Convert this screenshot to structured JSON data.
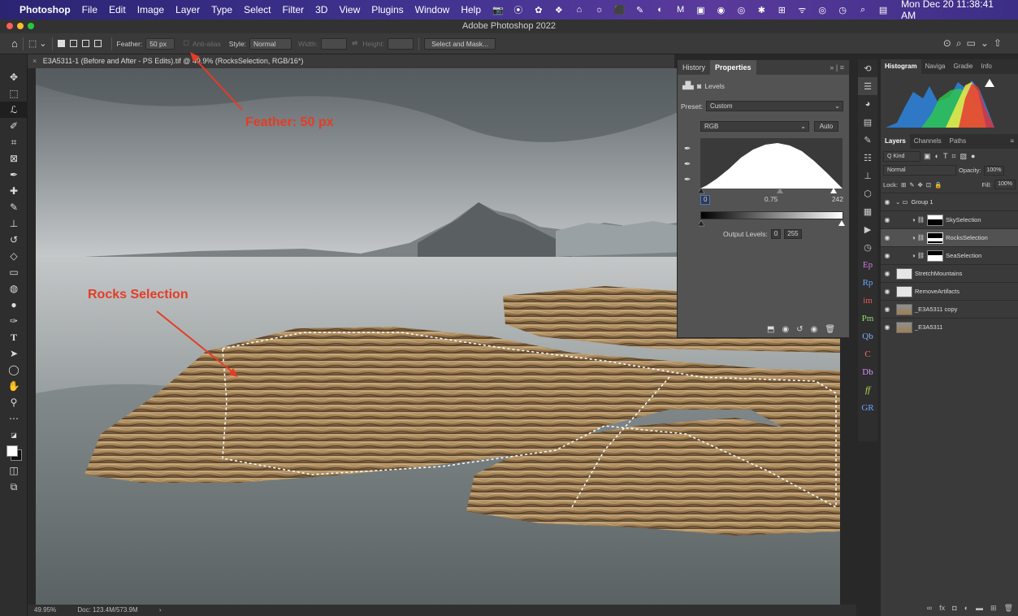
{
  "menubar": {
    "apple": "",
    "app": "Photoshop",
    "items": [
      "File",
      "Edit",
      "Image",
      "Layer",
      "Type",
      "Select",
      "Filter",
      "3D",
      "View",
      "Plugins",
      "Window",
      "Help"
    ],
    "status_icons": [
      "📷",
      "⦿",
      "✿",
      "❖",
      "⌂",
      "☼",
      "⬛",
      "✎",
      "◐",
      "M",
      "▣",
      "◉",
      "◎",
      "✱",
      "⊞",
      "ᯤ",
      "◎",
      "◷",
      "⌕",
      "▤"
    ],
    "datetime": "Mon Dec 20  11:38:41 AM"
  },
  "window": {
    "title": "Adobe Photoshop 2022"
  },
  "options": {
    "feather_label": "Feather:",
    "feather_value": "50 px",
    "antialias": "Anti-alias",
    "style_label": "Style:",
    "style_value": "Normal",
    "width_label": "Width:",
    "height_label": "Height:",
    "select_mask": "Select and Mask..."
  },
  "document": {
    "tab": "E3A5311-1 (Before and After - PS Edits).tif @ 49.9% (RocksSelection, RGB/16*)",
    "zoom": "49.95%",
    "doc_size": "Doc: 123.4M/573.9M"
  },
  "annotations": {
    "feather": "Feather: 50 px",
    "rocks": "Rocks Selection"
  },
  "properties": {
    "tabs": [
      "History",
      "Properties"
    ],
    "adjustment": "Levels",
    "preset_label": "Preset:",
    "preset_value": "Custom",
    "channel": "RGB",
    "auto": "Auto",
    "input_black": "0",
    "input_mid": "0.75",
    "input_white": "242",
    "output_label": "Output Levels:",
    "output_black": "0",
    "output_white": "255"
  },
  "right_panel": {
    "top_tabs": [
      "Histogram",
      "Naviga",
      "Gradie",
      "Info"
    ],
    "layer_tabs": [
      "Layers",
      "Channels",
      "Paths"
    ],
    "kind": "Q Kind",
    "blend": "Normal",
    "opacity_label": "Opacity:",
    "opacity_value": "100%",
    "lock_label": "Lock:",
    "fill_label": "Fill:",
    "fill_value": "100%",
    "layers": [
      {
        "name": "Group 1",
        "type": "group"
      },
      {
        "name": "SkySelection",
        "type": "adj"
      },
      {
        "name": "RocksSelection",
        "type": "adj",
        "active": true
      },
      {
        "name": "SeaSelection",
        "type": "adj"
      },
      {
        "name": "StretchMountains",
        "type": "pixel"
      },
      {
        "name": "RemoveArtifacts",
        "type": "pixel"
      },
      {
        "name": "_E3A5311 copy",
        "type": "photo"
      },
      {
        "name": "_E3A5311",
        "type": "photo"
      }
    ]
  },
  "plugin_labels": [
    "Ep",
    "Rp",
    "im",
    "Pm",
    "Qb",
    "C",
    "Db",
    "ff",
    "GR"
  ],
  "colors": {
    "menubar": "#3f338f",
    "annotation": "#e53c25",
    "accent": "#2d7fd6"
  }
}
